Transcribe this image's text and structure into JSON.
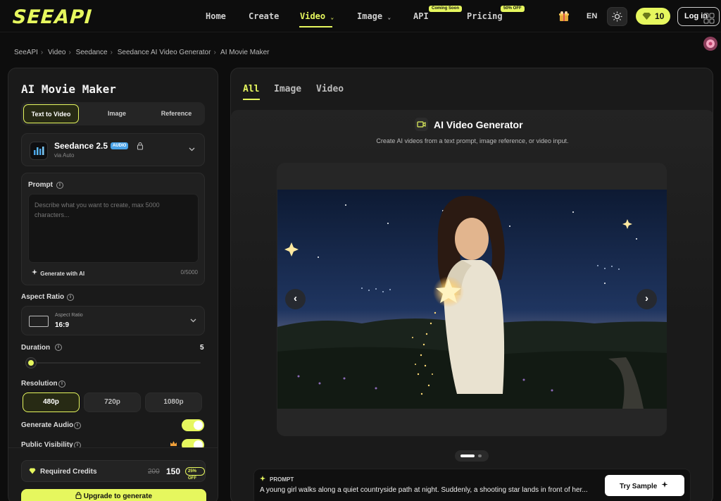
{
  "app": {
    "logo": "SEEAPI"
  },
  "nav": {
    "items": [
      "Home",
      "Create",
      "Video",
      "Image",
      "API",
      "Pricing"
    ],
    "api_badge": "Coming Soon",
    "pricing_badge": "50% OFF",
    "lang": "EN",
    "credits": "10",
    "login": "Log in"
  },
  "breadcrumb": [
    "SeeAPI",
    "Video",
    "Seedance",
    "Seedance AI Video Generator",
    "AI Movie Maker"
  ],
  "left": {
    "title": "AI Movie Maker",
    "mode_tabs": [
      "Text to Video",
      "Image",
      "Reference"
    ],
    "model": {
      "name": "Seedance 2.5",
      "badge": "AUDIO",
      "sub": "via Auto"
    },
    "prompt": {
      "label": "Prompt",
      "placeholder": "Describe what you want to create, max 5000 characters...",
      "generate_ai": "Generate with AI",
      "char_count": "0/5000"
    },
    "aspect": {
      "label": "Aspect Ratio",
      "field_label": "Aspect Ratio",
      "value": "16:9"
    },
    "duration": {
      "label": "Duration",
      "value": "5",
      "fraction": 0.0
    },
    "resolution": {
      "label": "Resolution",
      "options": [
        "480p",
        "720p",
        "1080p"
      ],
      "selected": "480p"
    },
    "generate_audio": {
      "label": "Generate Audio",
      "on": true
    },
    "public_visibility": {
      "label": "Public Visibility",
      "on": true
    },
    "footer": {
      "credits_label": "Required Credits",
      "old_cost": "200",
      "new_cost": "150",
      "discount": "25% OFF",
      "upgrade": "Upgrade to generate"
    }
  },
  "right": {
    "tabs": [
      "All",
      "Image",
      "Video"
    ],
    "active_tab": "All",
    "title": "AI Video Generator",
    "subtitle": "Create AI videos from a text prompt, image reference, or video input.",
    "prompt_label": "PROMPT",
    "prompt_text": "A young girl walks along a quiet countryside path at night. Suddenly, a shooting star lands in front of her...",
    "try_sample": "Try Sample"
  },
  "colors": {
    "accent": "#e6f75e",
    "background": "#0d0d0d",
    "panel": "#1a1a1a"
  }
}
